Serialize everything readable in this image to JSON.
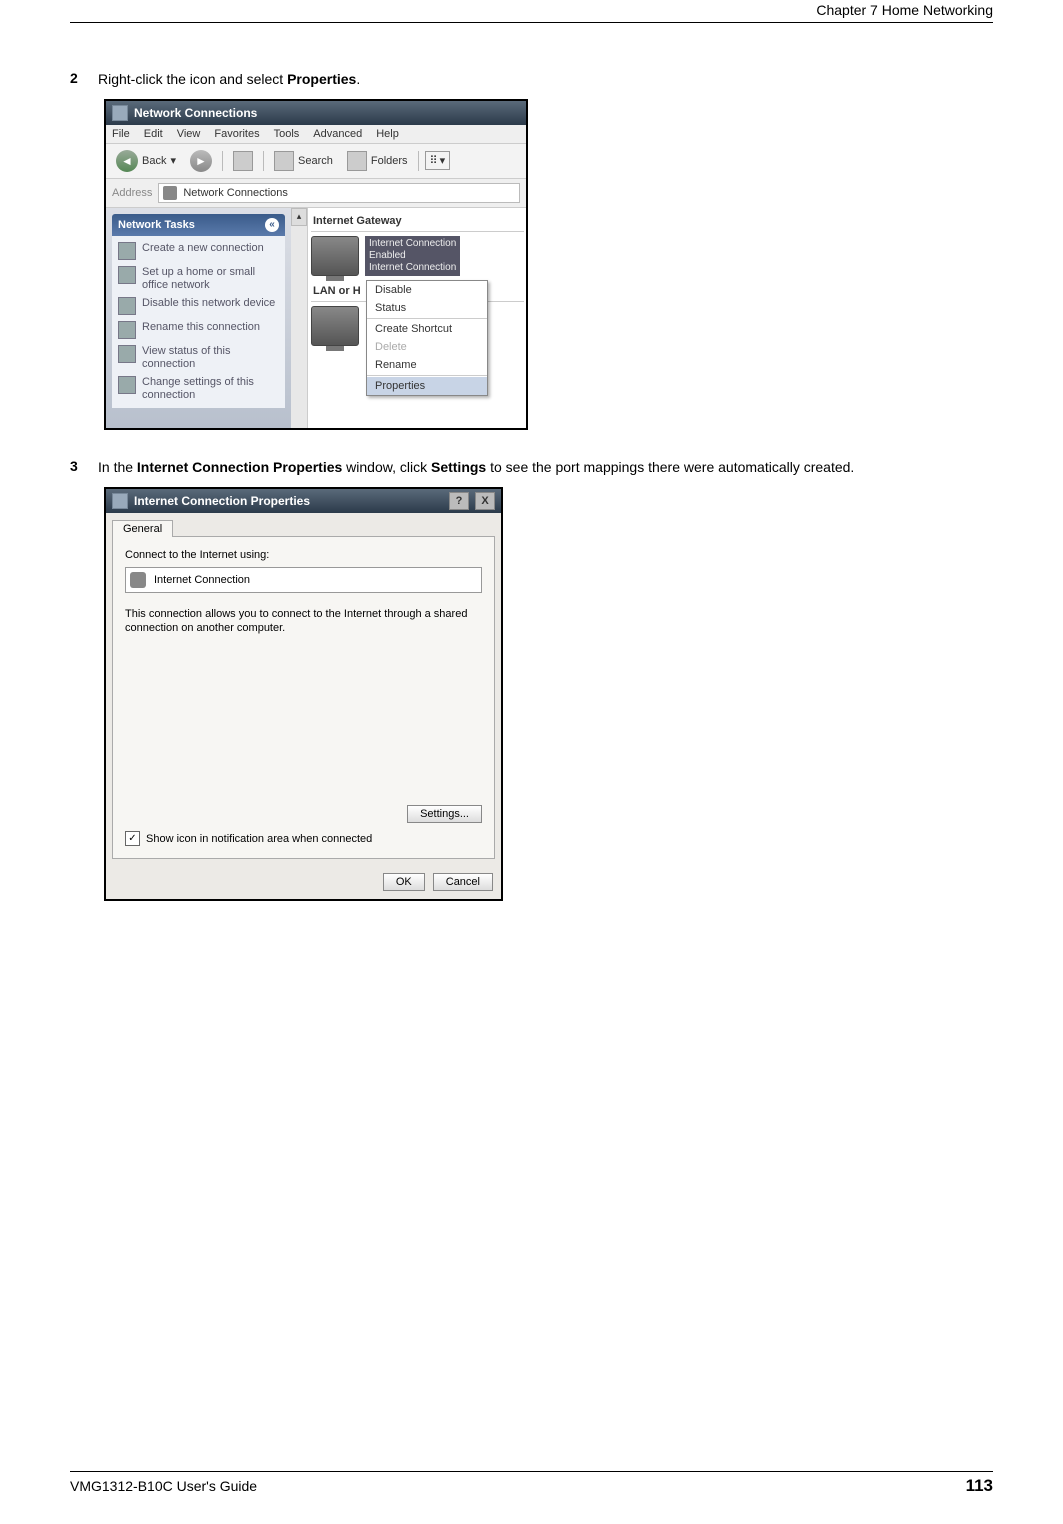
{
  "header": {
    "chapter": "Chapter 7 Home Networking"
  },
  "footer": {
    "guide": "VMG1312-B10C User's Guide",
    "page": "113"
  },
  "steps": {
    "s2": {
      "num": "2",
      "text_a": "Right-click the icon and select ",
      "text_b": "Properties",
      "text_c": "."
    },
    "s3": {
      "num": "3",
      "text_a": "In the ",
      "text_b": "Internet Connection Properties",
      "text_c": " window, click ",
      "text_d": "Settings",
      "text_e": " to see the port mappings there were automatically created."
    }
  },
  "shot1": {
    "title": "Network Connections",
    "menu": [
      "File",
      "Edit",
      "View",
      "Favorites",
      "Tools",
      "Advanced",
      "Help"
    ],
    "toolbar": {
      "back": "Back",
      "search": "Search",
      "folders": "Folders"
    },
    "address_label": "Address",
    "address_value": "Network Connections",
    "tasks_header": "Network Tasks",
    "tasks": [
      "Create a new connection",
      "Set up a home or small office network",
      "Disable this network device",
      "Rename this connection",
      "View status of this connection",
      "Change settings of this connection"
    ],
    "cat1": "Internet Gateway",
    "cat2": "LAN or H",
    "item1": {
      "l1": "Internet Connection",
      "l2": "Enabled",
      "l3": "Internet Connection"
    },
    "ctx": [
      "Disable",
      "Status",
      "Create Shortcut",
      "Delete",
      "Rename",
      "Properties"
    ]
  },
  "shot2": {
    "title": "Internet Connection Properties",
    "tab": "General",
    "connect_label": "Connect to the Internet using:",
    "connect_value": "Internet Connection",
    "desc": "This connection allows you to connect to the Internet through a shared connection on another computer.",
    "settings_btn": "Settings...",
    "checkbox": "Show icon in notification area when connected",
    "ok": "OK",
    "cancel": "Cancel",
    "help": "?",
    "close": "X"
  }
}
